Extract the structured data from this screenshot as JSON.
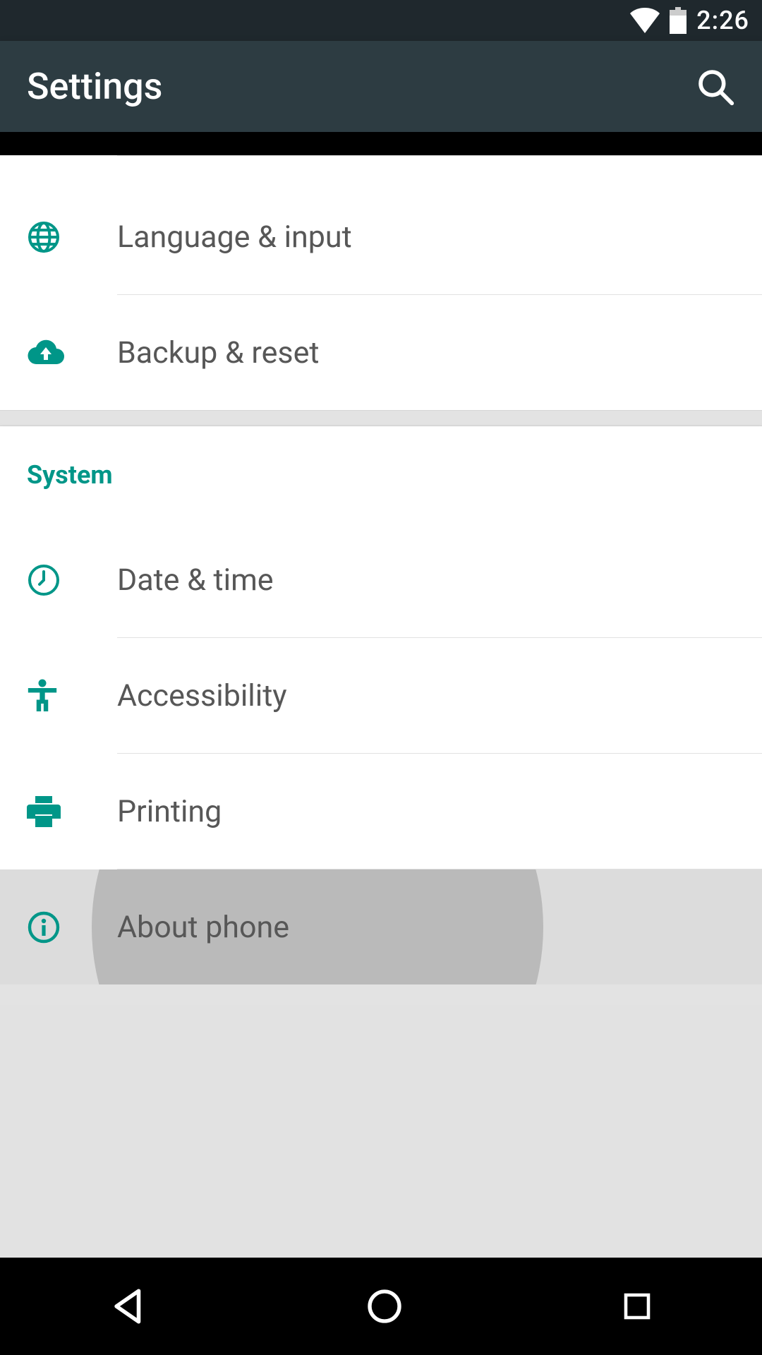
{
  "status": {
    "time": "2:26"
  },
  "appbar": {
    "title": "Settings"
  },
  "section1": {
    "items": [
      {
        "label": "Language & input"
      },
      {
        "label": "Backup & reset"
      }
    ]
  },
  "section2": {
    "header": "System",
    "items": [
      {
        "label": "Date & time"
      },
      {
        "label": "Accessibility"
      },
      {
        "label": "Printing"
      },
      {
        "label": "About phone"
      }
    ]
  }
}
